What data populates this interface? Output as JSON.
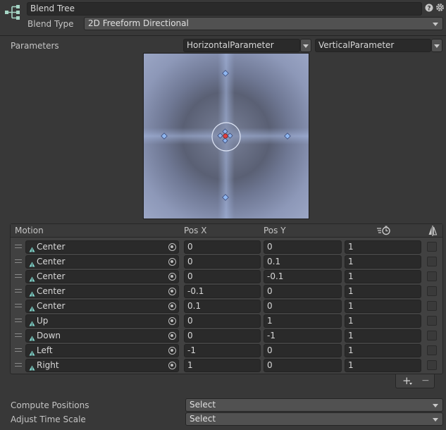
{
  "header": {
    "node_icon": "blend-tree-node-icon",
    "name_value": "Blend Tree",
    "help_icon": "help-icon",
    "settings_icon": "gear-icon",
    "blend_type_label": "Blend Type",
    "blend_type_value": "2D Freeform Directional"
  },
  "parameters": {
    "label": "Parameters",
    "horizontal": "HorizontalParameter",
    "vertical": "VerticalParameter"
  },
  "table": {
    "col_motion": "Motion",
    "col_pos_x": "Pos X",
    "col_pos_y": "Pos Y",
    "col_speed_icon": "time-scale-icon",
    "col_mirror_icon": "mirror-icon",
    "rows": [
      {
        "motion": "Center",
        "x": "0",
        "y": "0",
        "speed": "1"
      },
      {
        "motion": "Center",
        "x": "0",
        "y": "0.1",
        "speed": "1"
      },
      {
        "motion": "Center",
        "x": "0",
        "y": "-0.1",
        "speed": "1"
      },
      {
        "motion": "Center",
        "x": "-0.1",
        "y": "0",
        "speed": "1"
      },
      {
        "motion": "Center",
        "x": "0.1",
        "y": "0",
        "speed": "1"
      },
      {
        "motion": "Up",
        "x": "0",
        "y": "1",
        "speed": "1"
      },
      {
        "motion": "Down",
        "x": "0",
        "y": "-1",
        "speed": "1"
      },
      {
        "motion": "Left",
        "x": "-1",
        "y": "0",
        "speed": "1"
      },
      {
        "motion": "Right",
        "x": "1",
        "y": "0",
        "speed": "1"
      }
    ],
    "add_label": "+",
    "remove_label": "−"
  },
  "footer": {
    "compute_label": "Compute Positions",
    "compute_value": "Select",
    "adjust_label": "Adjust Time Scale",
    "adjust_value": "Select"
  },
  "colors": {
    "accent_blue": "#8fb6f0",
    "center_red": "#e04040"
  }
}
